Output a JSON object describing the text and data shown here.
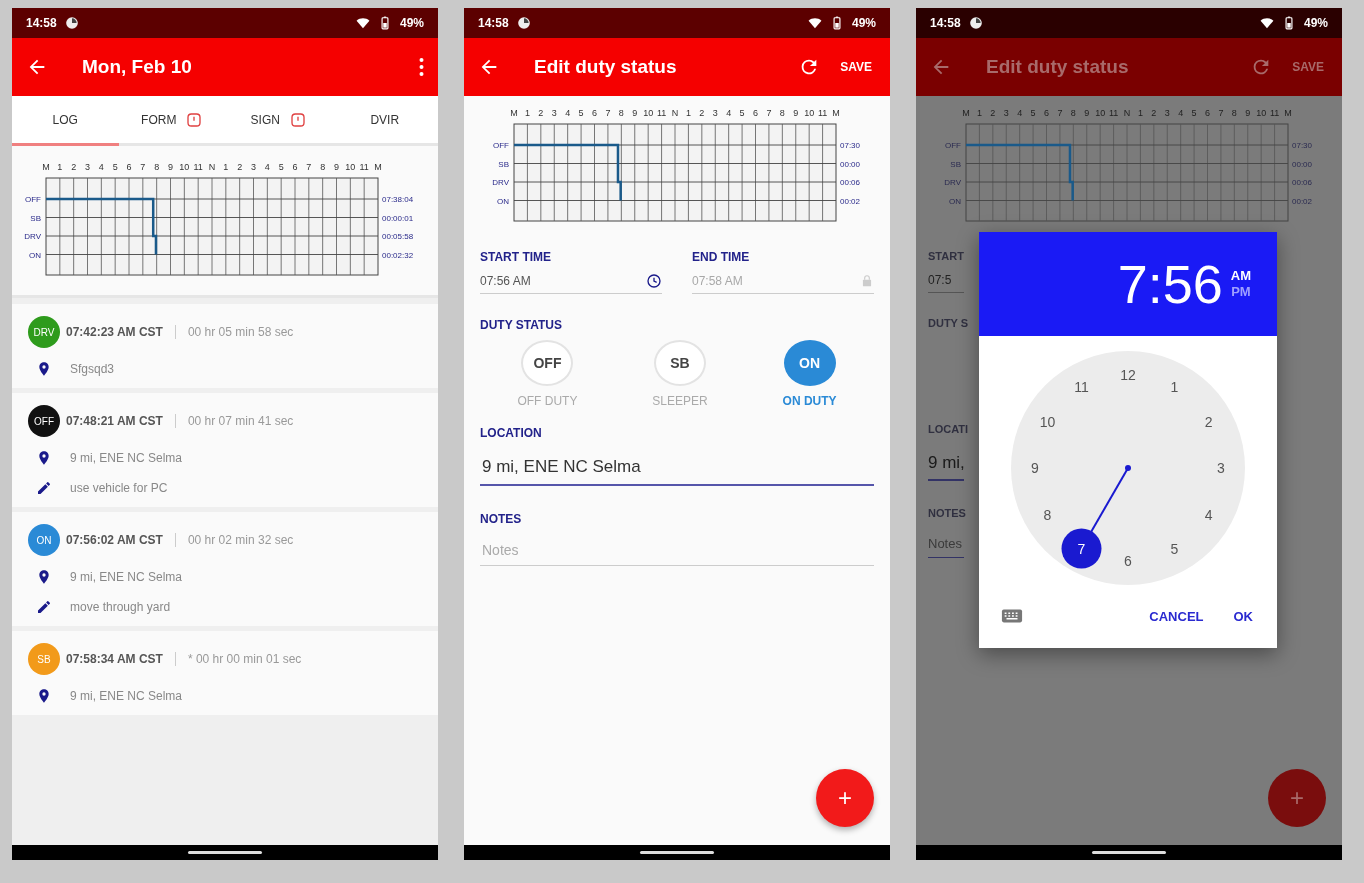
{
  "screens": [
    {
      "kind": "log",
      "status_bar": {
        "time": "14:58",
        "battery": "49%"
      },
      "app_bar": {
        "title": "Mon, Feb 10"
      },
      "tabs": [
        {
          "label": "LOG",
          "selected": true,
          "alert": false
        },
        {
          "label": "FORM",
          "selected": false,
          "alert": true
        },
        {
          "label": "SIGN",
          "selected": false,
          "alert": true
        },
        {
          "label": "DVIR",
          "selected": false,
          "alert": false
        }
      ],
      "grid": {
        "hours": [
          "M",
          "1",
          "2",
          "3",
          "4",
          "5",
          "6",
          "7",
          "8",
          "9",
          "10",
          "11",
          "N",
          "1",
          "2",
          "3",
          "4",
          "5",
          "6",
          "7",
          "8",
          "9",
          "10",
          "11",
          "M"
        ],
        "rows": [
          "OFF",
          "SB",
          "DRV",
          "ON"
        ],
        "totals": [
          "07:38:04",
          "00:00:01",
          "00:05:58",
          "00:02:32"
        ]
      },
      "events": [
        {
          "status": "DRV",
          "color": "#2e9b1c",
          "time": "07:42:23 AM CST",
          "duration": "00 hr 05 min 58 sec",
          "details": [
            {
              "kind": "location",
              "text": "Sfgsqd3"
            }
          ]
        },
        {
          "status": "OFF",
          "color": "#111111",
          "time": "07:48:21 AM CST",
          "duration": "00 hr 07 min 41 sec",
          "details": [
            {
              "kind": "location",
              "text": "9 mi, ENE NC Selma"
            },
            {
              "kind": "note",
              "text": "use vehicle for PC"
            }
          ]
        },
        {
          "status": "ON",
          "color": "#2a8ad6",
          "time": "07:56:02 AM CST",
          "duration": "00 hr 02 min 32 sec",
          "details": [
            {
              "kind": "location",
              "text": "9 mi, ENE NC Selma"
            },
            {
              "kind": "note",
              "text": "move through yard"
            }
          ]
        },
        {
          "status": "SB",
          "color": "#f29a1a",
          "time": "07:58:34 AM CST",
          "duration": "* 00 hr 00 min 01 sec",
          "details": [
            {
              "kind": "location",
              "text": "9 mi, ENE NC Selma"
            }
          ]
        }
      ]
    },
    {
      "kind": "edit",
      "status_bar": {
        "time": "14:58",
        "battery": "49%"
      },
      "app_bar": {
        "title": "Edit duty status",
        "action": "SAVE"
      },
      "grid": {
        "hours": [
          "M",
          "1",
          "2",
          "3",
          "4",
          "5",
          "6",
          "7",
          "8",
          "9",
          "10",
          "11",
          "N",
          "1",
          "2",
          "3",
          "4",
          "5",
          "6",
          "7",
          "8",
          "9",
          "10",
          "11",
          "M"
        ],
        "rows": [
          "OFF",
          "SB",
          "DRV",
          "ON"
        ],
        "totals": [
          "07:30",
          "00:00",
          "00:06",
          "00:02"
        ]
      },
      "form": {
        "start": {
          "label": "START TIME",
          "value": "07:56 AM"
        },
        "end": {
          "label": "END TIME",
          "value": "07:58 AM",
          "disabled": true
        },
        "duty": {
          "label": "DUTY STATUS",
          "options": [
            {
              "code": "OFF",
              "label": "OFF DUTY",
              "selected": false
            },
            {
              "code": "SB",
              "label": "SLEEPER",
              "selected": false
            },
            {
              "code": "ON",
              "label": "ON DUTY",
              "selected": true
            }
          ]
        },
        "location": {
          "label": "LOCATION",
          "value": "9 mi, ENE NC Selma"
        },
        "notes": {
          "label": "NOTES",
          "placeholder": "Notes"
        }
      },
      "fab": "+"
    },
    {
      "kind": "picker",
      "status_bar": {
        "time": "14:58",
        "battery": "49%"
      },
      "app_bar": {
        "title": "Edit duty status",
        "action": "SAVE"
      },
      "grid": {
        "hours": [
          "M",
          "1",
          "2",
          "3",
          "4",
          "5",
          "6",
          "7",
          "8",
          "9",
          "10",
          "11",
          "N",
          "1",
          "2",
          "3",
          "4",
          "5",
          "6",
          "7",
          "8",
          "9",
          "10",
          "11",
          "M"
        ],
        "rows": [
          "OFF",
          "SB",
          "DRV",
          "ON"
        ],
        "totals": [
          "07:30",
          "00:00",
          "00:06",
          "00:02"
        ]
      },
      "form": {
        "start": {
          "label": "START",
          "value": "07:5"
        },
        "duty": {
          "label": "DUTY S"
        },
        "location": {
          "label": "LOCATI",
          "value": "9 mi,"
        },
        "notes": {
          "label": "NOTES",
          "placeholder": "Notes"
        }
      },
      "fab": "+",
      "dialog": {
        "time": "7:56",
        "periods": [
          {
            "label": "AM",
            "selected": true
          },
          {
            "label": "PM",
            "selected": false
          }
        ],
        "dial": [
          {
            "label": "12",
            "selected": false
          },
          {
            "label": "1",
            "selected": false
          },
          {
            "label": "2",
            "selected": false
          },
          {
            "label": "3",
            "selected": false
          },
          {
            "label": "4",
            "selected": false
          },
          {
            "label": "5",
            "selected": false
          },
          {
            "label": "6",
            "selected": false
          },
          {
            "label": "7",
            "selected": true
          },
          {
            "label": "8",
            "selected": false
          },
          {
            "label": "9",
            "selected": false
          },
          {
            "label": "10",
            "selected": false
          },
          {
            "label": "11",
            "selected": false
          }
        ],
        "buttons": [
          "CANCEL",
          "OK"
        ]
      }
    }
  ]
}
